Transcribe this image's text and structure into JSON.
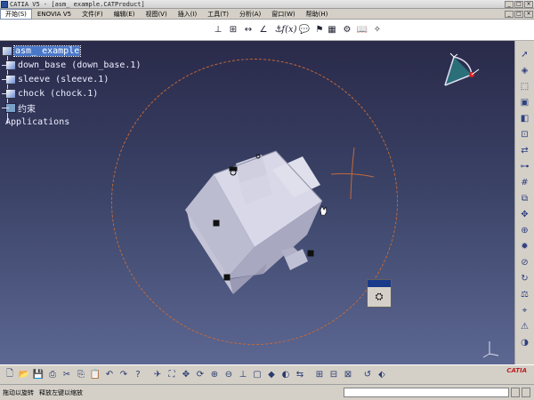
{
  "window": {
    "title": "CATIA V5 - [asm_ example.CATProduct]"
  },
  "menubar": {
    "items": [
      "开始(S)",
      "ENOVIA V5",
      "文件(F)",
      "编辑(E)",
      "视图(V)",
      "插入(I)",
      "工具(T)",
      "分析(A)",
      "窗口(W)",
      "帮助(H)"
    ]
  },
  "tree": {
    "root": "asm_ example",
    "children": [
      "down_base (down_base.1)",
      "sleeve (sleeve.1)",
      "chock (chock.1)",
      "约束"
    ],
    "applications": "Applications"
  },
  "status": {
    "hint1": "拖动以旋转",
    "hint2": "释放左键以缩放",
    "command_value": ""
  },
  "brand": {
    "logo_text": "CATIA"
  },
  "colors": {
    "viewport_top": "#2a2a4a",
    "viewport_bottom": "#5c6792",
    "selection_circle": "#c46a3a",
    "tree_selected": "#4a78c8",
    "part_face": "#c8c8dc"
  }
}
